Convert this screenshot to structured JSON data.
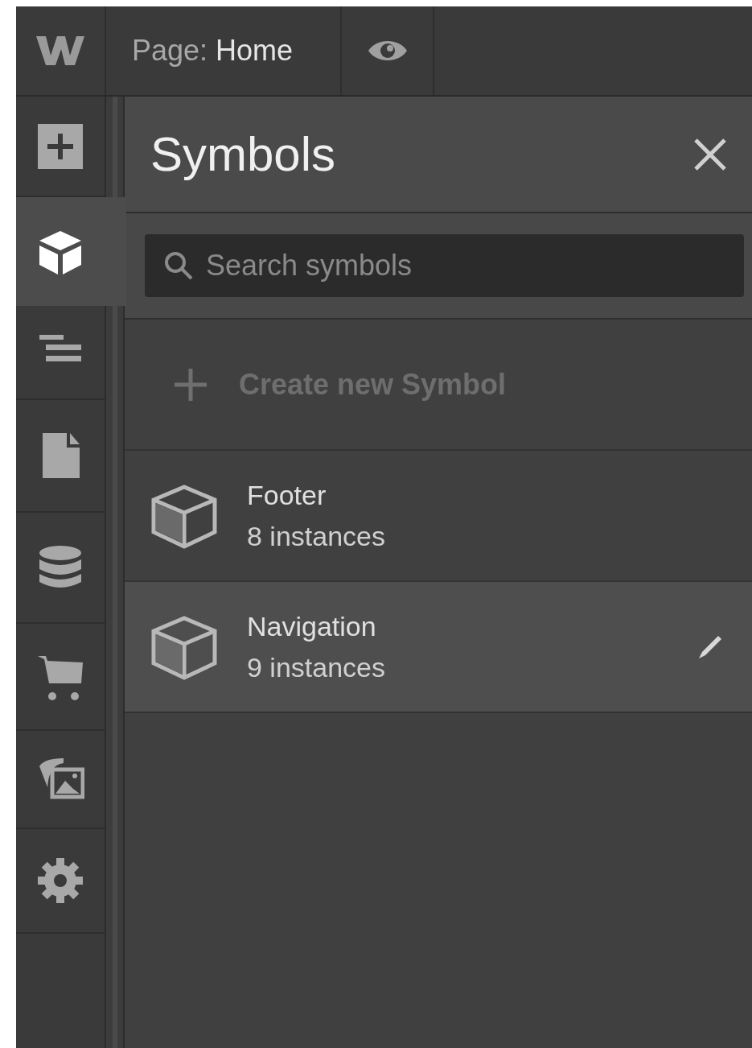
{
  "top_bar": {
    "page_label": "Page:",
    "page_name": "Home"
  },
  "sidebar": {
    "items": [
      {
        "kind": "add",
        "selected": false
      },
      {
        "kind": "symbols",
        "selected": true
      },
      {
        "kind": "navigator",
        "selected": false
      },
      {
        "kind": "pages",
        "selected": false
      },
      {
        "kind": "cms",
        "selected": false
      },
      {
        "kind": "ecommerce",
        "selected": false
      },
      {
        "kind": "assets",
        "selected": false
      },
      {
        "kind": "settings",
        "selected": false
      }
    ]
  },
  "panel": {
    "title": "Symbols",
    "search": {
      "placeholder": "Search symbols"
    },
    "create_label": "Create new Symbol",
    "symbols": [
      {
        "name": "Footer",
        "count": "8 instances",
        "selected": false
      },
      {
        "name": "Navigation",
        "count": "9 instances",
        "selected": true
      }
    ]
  }
}
